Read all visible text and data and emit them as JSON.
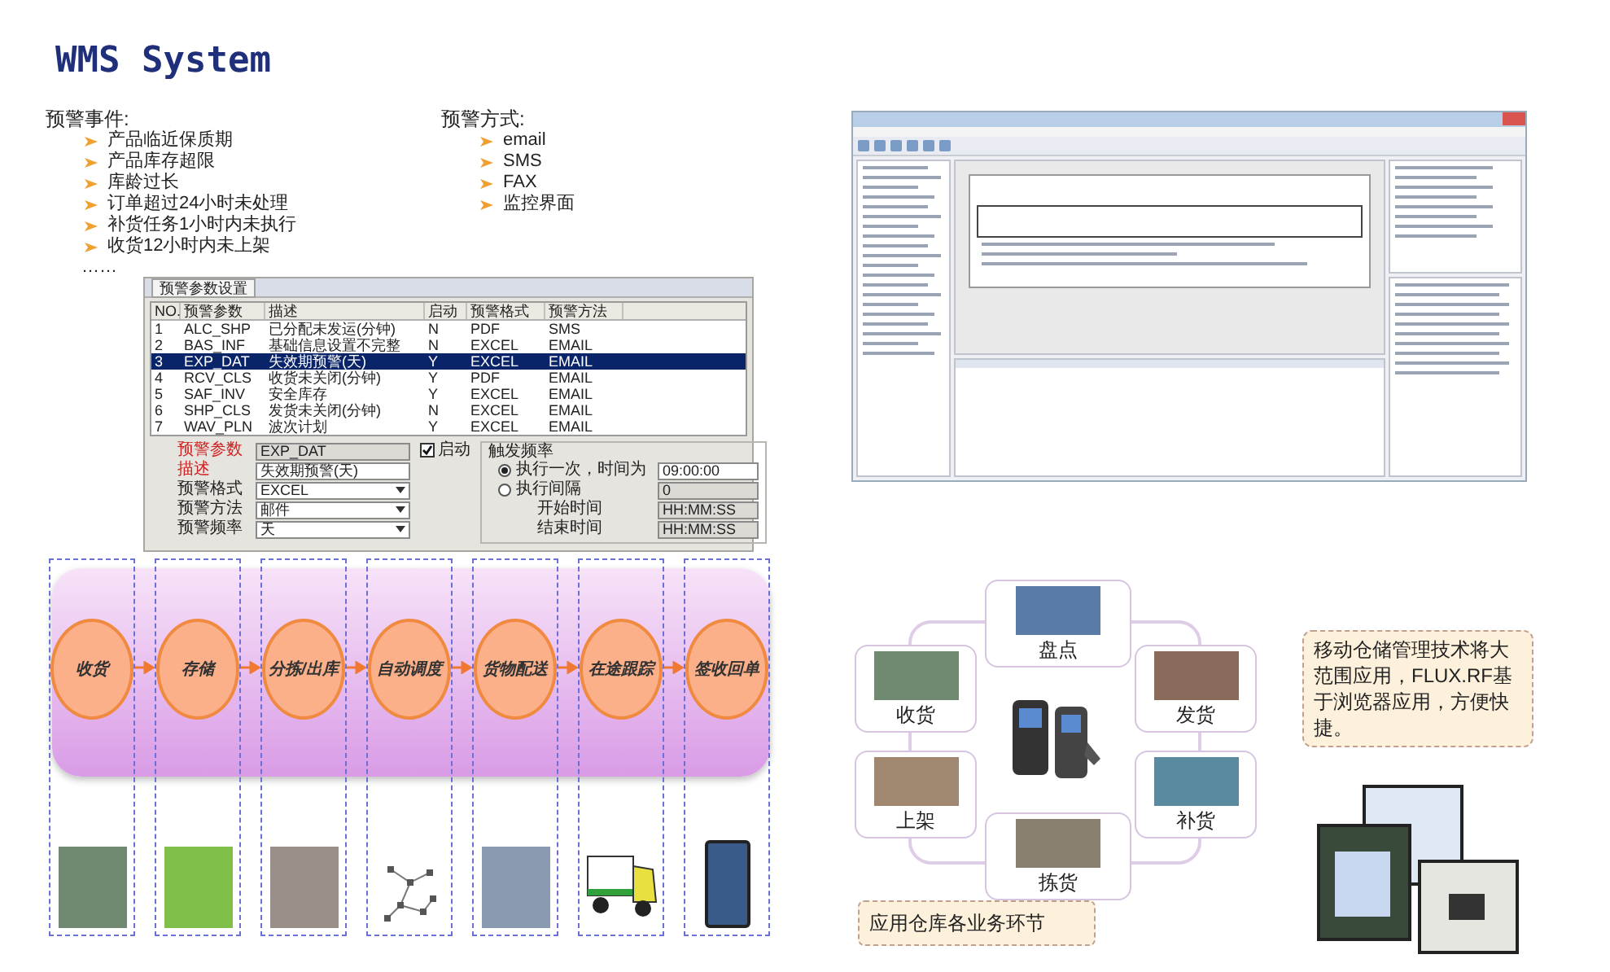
{
  "title": "WMS System",
  "alert_events": {
    "heading": "预警事件:",
    "items": [
      "产品临近保质期",
      "产品库存超限",
      "库龄过长",
      "订单超过24小时未处理",
      "补货任务1小时内未执行",
      "收货12小时内未上架"
    ],
    "more": "……"
  },
  "alert_methods": {
    "heading": "预警方式:",
    "items": [
      "email",
      "SMS",
      "FAX",
      "监控界面"
    ]
  },
  "alert_dialog": {
    "tab": "预警参数设置",
    "columns": [
      "NO.",
      "预警参数",
      "描述",
      "启动",
      "预警格式",
      "预警方法"
    ],
    "rows": [
      {
        "cells": [
          "1",
          "ALC_SHP",
          "已分配未发运(分钟)",
          "N",
          "PDF",
          "SMS"
        ],
        "selected": false
      },
      {
        "cells": [
          "2",
          "BAS_INF",
          "基础信息设置不完整",
          "N",
          "EXCEL",
          "EMAIL"
        ],
        "selected": false
      },
      {
        "cells": [
          "3",
          "EXP_DAT",
          "失效期预警(天)",
          "Y",
          "EXCEL",
          "EMAIL"
        ],
        "selected": true
      },
      {
        "cells": [
          "4",
          "RCV_CLS",
          "收货未关闭(分钟)",
          "Y",
          "PDF",
          "EMAIL"
        ],
        "selected": false
      },
      {
        "cells": [
          "5",
          "SAF_INV",
          "安全库存",
          "Y",
          "EXCEL",
          "EMAIL"
        ],
        "selected": false
      },
      {
        "cells": [
          "6",
          "SHP_CLS",
          "发货未关闭(分钟)",
          "N",
          "EXCEL",
          "EMAIL"
        ],
        "selected": false
      },
      {
        "cells": [
          "7",
          "WAV_PLN",
          "波次计划",
          "Y",
          "EXCEL",
          "EMAIL"
        ],
        "selected": false
      }
    ],
    "fields": [
      {
        "label": "预警参数",
        "value": "EXP_DAT",
        "required": true,
        "kind": "readonly"
      },
      {
        "label": "描述",
        "value": "失效期预警(天)",
        "required": true,
        "kind": "text"
      },
      {
        "label": "预警格式",
        "value": "EXCEL",
        "required": false,
        "kind": "select"
      },
      {
        "label": "预警方法",
        "value": "邮件",
        "required": false,
        "kind": "select"
      },
      {
        "label": "预警频率",
        "value": "天",
        "required": false,
        "kind": "select"
      }
    ],
    "enable": {
      "label": "启动",
      "checked": true
    },
    "trigger": {
      "title": "触发频率",
      "options": [
        {
          "label": "执行一次，时间为",
          "selected": true,
          "value": "09:00:00"
        },
        {
          "label": "执行间隔",
          "selected": false,
          "value": "0"
        }
      ],
      "times": [
        {
          "label": "开始时间",
          "value": "HH:MM:SS"
        },
        {
          "label": "结束时间",
          "value": "HH:MM:SS"
        }
      ]
    }
  },
  "process_flow": {
    "steps": [
      {
        "label": "收货"
      },
      {
        "label": "存储"
      },
      {
        "label": "分拣/出库"
      },
      {
        "label": "自动调度"
      },
      {
        "label": "货物配送"
      },
      {
        "label": "在途跟踪"
      },
      {
        "label": "签收回单"
      }
    ]
  },
  "rf_diagram": {
    "nodes": [
      {
        "label": "盘点"
      },
      {
        "label": "收货"
      },
      {
        "label": "发货"
      },
      {
        "label": "上架"
      },
      {
        "label": "补货"
      },
      {
        "label": "拣货"
      }
    ],
    "caption": "应用仓库各业务环节"
  },
  "rf_note": "移动仓储管理技术将大范围应用，FLUX.RF基于浏览器应用，方便快捷。"
}
